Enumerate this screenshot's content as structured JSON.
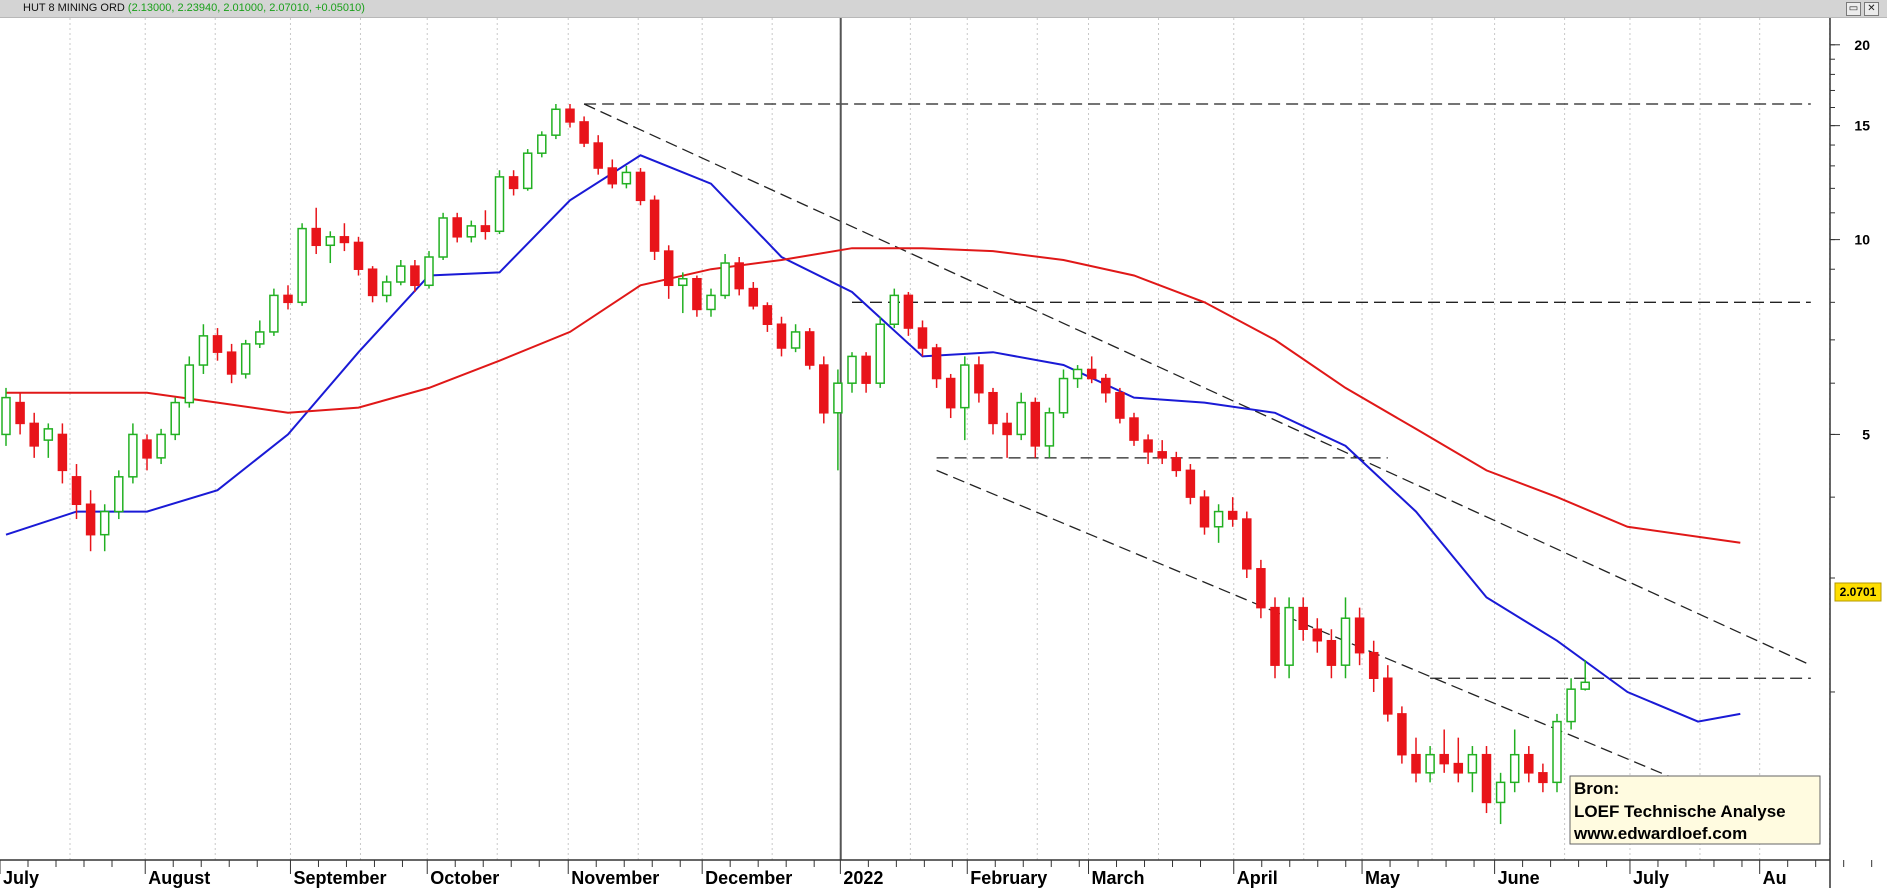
{
  "window": {
    "title": "HUT 8 MINING ORD",
    "ohlc_text": "(2.13000, 2.23940, 2.01000, 2.07010, +0.05010)",
    "restore_icon": "restore-icon",
    "close_icon": "close-icon",
    "restore_glyph": "▭",
    "close_glyph": "✕"
  },
  "colors": {
    "up": "#22b022",
    "down": "#e8141a",
    "ma_short": "#1a1ad6",
    "ma_long": "#e01818",
    "grid": "#c8c8c8",
    "last_price_bg": "#ffde00"
  },
  "chart_data": {
    "type": "candlestick",
    "title": "HUT 8 MINING ORD",
    "y_scale": "log",
    "ylim": [
      1.1,
      22
    ],
    "yticks": [
      20,
      15,
      10,
      5
    ],
    "x_labels": [
      "July",
      "August",
      "September",
      "October",
      "November",
      "December",
      "2022",
      "February",
      "March",
      "April",
      "May",
      "June",
      "July",
      "Au"
    ],
    "grid": true,
    "last_price": "2.0701",
    "last_value": 2.0701,
    "moving_averages": [
      {
        "color": "#1a1ad6",
        "points": [
          [
            0,
            3.5
          ],
          [
            5,
            3.8
          ],
          [
            10,
            3.8
          ],
          [
            15,
            4.1
          ],
          [
            20,
            5.0
          ],
          [
            25,
            6.7
          ],
          [
            30,
            8.8
          ],
          [
            35,
            8.9
          ],
          [
            40,
            11.5
          ],
          [
            45,
            13.5
          ],
          [
            50,
            12.2
          ],
          [
            55,
            9.4
          ],
          [
            60,
            8.3
          ],
          [
            65,
            6.6
          ],
          [
            70,
            6.7
          ],
          [
            75,
            6.4
          ],
          [
            80,
            5.7
          ],
          [
            85,
            5.6
          ],
          [
            90,
            5.4
          ],
          [
            95,
            4.8
          ],
          [
            100,
            3.8
          ],
          [
            105,
            2.8
          ],
          [
            110,
            2.4
          ],
          [
            115,
            2.0
          ],
          [
            120,
            1.8
          ],
          [
            123,
            1.85
          ]
        ]
      },
      {
        "color": "#e01818",
        "points": [
          [
            0,
            5.8
          ],
          [
            10,
            5.8
          ],
          [
            15,
            5.6
          ],
          [
            20,
            5.4
          ],
          [
            25,
            5.5
          ],
          [
            30,
            5.9
          ],
          [
            35,
            6.5
          ],
          [
            40,
            7.2
          ],
          [
            45,
            8.5
          ],
          [
            50,
            9.0
          ],
          [
            55,
            9.3
          ],
          [
            60,
            9.7
          ],
          [
            65,
            9.7
          ],
          [
            70,
            9.6
          ],
          [
            75,
            9.3
          ],
          [
            80,
            8.8
          ],
          [
            85,
            8.0
          ],
          [
            90,
            7.0
          ],
          [
            95,
            5.9
          ],
          [
            100,
            5.1
          ],
          [
            105,
            4.4
          ],
          [
            110,
            4.0
          ],
          [
            115,
            3.6
          ],
          [
            123,
            3.4
          ]
        ]
      }
    ],
    "trendlines": [
      {
        "from": [
          41,
          16.2
        ],
        "to": [
          128,
          16.2
        ]
      },
      {
        "from": [
          41,
          16.2
        ],
        "to": [
          128,
          2.2
        ]
      },
      {
        "from": [
          60,
          8.0
        ],
        "to": [
          128,
          8.0
        ]
      },
      {
        "from": [
          66,
          4.4
        ],
        "to": [
          128,
          1.2
        ]
      },
      {
        "from": [
          66,
          4.6
        ],
        "to": [
          98,
          4.6
        ]
      },
      {
        "from": [
          101,
          2.1
        ],
        "to": [
          128,
          2.1
        ]
      }
    ],
    "cursor_x": 59.2,
    "candles": [
      [
        5.0,
        5.9,
        4.8,
        5.7
      ],
      [
        5.6,
        5.8,
        5.0,
        5.2
      ],
      [
        5.2,
        5.4,
        4.6,
        4.8
      ],
      [
        4.9,
        5.2,
        4.6,
        5.1
      ],
      [
        5.0,
        5.2,
        4.2,
        4.4
      ],
      [
        4.3,
        4.5,
        3.7,
        3.9
      ],
      [
        3.9,
        4.1,
        3.3,
        3.5
      ],
      [
        3.5,
        3.9,
        3.3,
        3.8
      ],
      [
        3.8,
        4.4,
        3.7,
        4.3
      ],
      [
        4.3,
        5.2,
        4.2,
        5.0
      ],
      [
        4.9,
        5.0,
        4.4,
        4.6
      ],
      [
        4.6,
        5.1,
        4.5,
        5.0
      ],
      [
        5.0,
        5.7,
        4.9,
        5.6
      ],
      [
        5.6,
        6.6,
        5.5,
        6.4
      ],
      [
        6.4,
        7.4,
        6.2,
        7.1
      ],
      [
        7.1,
        7.3,
        6.5,
        6.7
      ],
      [
        6.7,
        6.9,
        6.0,
        6.2
      ],
      [
        6.2,
        7.0,
        6.1,
        6.9
      ],
      [
        6.9,
        7.5,
        6.8,
        7.2
      ],
      [
        7.2,
        8.4,
        7.1,
        8.2
      ],
      [
        8.2,
        8.5,
        7.8,
        8.0
      ],
      [
        8.0,
        10.6,
        7.9,
        10.4
      ],
      [
        10.4,
        11.2,
        9.5,
        9.8
      ],
      [
        9.8,
        10.3,
        9.2,
        10.1
      ],
      [
        10.1,
        10.6,
        9.6,
        9.9
      ],
      [
        9.9,
        10.1,
        8.8,
        9.0
      ],
      [
        9.0,
        9.1,
        8.0,
        8.2
      ],
      [
        8.2,
        8.8,
        8.0,
        8.6
      ],
      [
        8.6,
        9.3,
        8.5,
        9.1
      ],
      [
        9.1,
        9.3,
        8.3,
        8.5
      ],
      [
        8.5,
        9.6,
        8.4,
        9.4
      ],
      [
        9.4,
        11.0,
        9.3,
        10.8
      ],
      [
        10.8,
        11.0,
        9.9,
        10.1
      ],
      [
        10.1,
        10.7,
        9.9,
        10.5
      ],
      [
        10.5,
        11.1,
        10.0,
        10.3
      ],
      [
        10.3,
        12.8,
        10.2,
        12.5
      ],
      [
        12.5,
        12.8,
        11.7,
        12.0
      ],
      [
        12.0,
        13.8,
        11.9,
        13.6
      ],
      [
        13.6,
        14.7,
        13.4,
        14.5
      ],
      [
        14.5,
        16.2,
        14.3,
        15.9
      ],
      [
        15.9,
        16.2,
        14.9,
        15.2
      ],
      [
        15.2,
        15.5,
        13.9,
        14.1
      ],
      [
        14.1,
        14.5,
        12.6,
        12.9
      ],
      [
        12.9,
        13.3,
        12.0,
        12.2
      ],
      [
        12.2,
        13.0,
        12.0,
        12.7
      ],
      [
        12.7,
        12.9,
        11.3,
        11.5
      ],
      [
        11.5,
        11.7,
        9.3,
        9.6
      ],
      [
        9.6,
        9.8,
        8.1,
        8.5
      ],
      [
        8.5,
        8.9,
        7.7,
        8.7
      ],
      [
        8.7,
        8.8,
        7.6,
        7.8
      ],
      [
        7.8,
        8.4,
        7.6,
        8.2
      ],
      [
        8.2,
        9.5,
        8.1,
        9.2
      ],
      [
        9.2,
        9.4,
        8.2,
        8.4
      ],
      [
        8.4,
        8.6,
        7.8,
        7.9
      ],
      [
        7.9,
        8.0,
        7.2,
        7.4
      ],
      [
        7.4,
        7.6,
        6.6,
        6.8
      ],
      [
        6.8,
        7.4,
        6.7,
        7.2
      ],
      [
        7.2,
        7.3,
        6.3,
        6.4
      ],
      [
        6.4,
        6.6,
        5.2,
        5.4
      ],
      [
        5.4,
        6.3,
        4.4,
        6.0
      ],
      [
        6.0,
        6.7,
        5.8,
        6.6
      ],
      [
        6.6,
        6.7,
        5.8,
        6.0
      ],
      [
        6.0,
        7.6,
        5.9,
        7.4
      ],
      [
        7.4,
        8.4,
        7.3,
        8.2
      ],
      [
        8.2,
        8.3,
        7.1,
        7.3
      ],
      [
        7.3,
        7.5,
        6.6,
        6.8
      ],
      [
        6.8,
        6.9,
        5.9,
        6.1
      ],
      [
        6.1,
        6.2,
        5.3,
        5.5
      ],
      [
        5.5,
        6.6,
        4.9,
        6.4
      ],
      [
        6.4,
        6.6,
        5.6,
        5.8
      ],
      [
        5.8,
        5.9,
        5.0,
        5.2
      ],
      [
        5.2,
        5.4,
        4.6,
        5.0
      ],
      [
        5.0,
        5.8,
        4.9,
        5.6
      ],
      [
        5.6,
        5.7,
        4.6,
        4.8
      ],
      [
        4.8,
        5.5,
        4.6,
        5.4
      ],
      [
        5.4,
        6.3,
        5.3,
        6.1
      ],
      [
        6.1,
        6.4,
        5.9,
        6.3
      ],
      [
        6.3,
        6.6,
        6.0,
        6.1
      ],
      [
        6.1,
        6.2,
        5.6,
        5.8
      ],
      [
        5.8,
        5.9,
        5.2,
        5.3
      ],
      [
        5.3,
        5.4,
        4.8,
        4.9
      ],
      [
        4.9,
        5.0,
        4.5,
        4.7
      ],
      [
        4.7,
        4.9,
        4.5,
        4.6
      ],
      [
        4.6,
        4.7,
        4.3,
        4.4
      ],
      [
        4.4,
        4.5,
        3.9,
        4.0
      ],
      [
        4.0,
        4.1,
        3.5,
        3.6
      ],
      [
        3.6,
        3.9,
        3.4,
        3.8
      ],
      [
        3.8,
        4.0,
        3.6,
        3.7
      ],
      [
        3.7,
        3.8,
        3.0,
        3.1
      ],
      [
        3.1,
        3.2,
        2.6,
        2.7
      ],
      [
        2.7,
        2.8,
        2.1,
        2.2
      ],
      [
        2.2,
        2.8,
        2.1,
        2.7
      ],
      [
        2.7,
        2.8,
        2.4,
        2.5
      ],
      [
        2.5,
        2.6,
        2.3,
        2.4
      ],
      [
        2.4,
        2.5,
        2.1,
        2.2
      ],
      [
        2.2,
        2.8,
        2.1,
        2.6
      ],
      [
        2.6,
        2.7,
        2.2,
        2.3
      ],
      [
        2.3,
        2.4,
        2.0,
        2.1
      ],
      [
        2.1,
        2.2,
        1.8,
        1.85
      ],
      [
        1.85,
        1.9,
        1.55,
        1.6
      ],
      [
        1.6,
        1.7,
        1.45,
        1.5
      ],
      [
        1.5,
        1.65,
        1.45,
        1.6
      ],
      [
        1.6,
        1.75,
        1.5,
        1.55
      ],
      [
        1.55,
        1.7,
        1.45,
        1.5
      ],
      [
        1.5,
        1.65,
        1.4,
        1.6
      ],
      [
        1.6,
        1.65,
        1.3,
        1.35
      ],
      [
        1.35,
        1.5,
        1.25,
        1.45
      ],
      [
        1.45,
        1.75,
        1.4,
        1.6
      ],
      [
        1.6,
        1.65,
        1.45,
        1.5
      ],
      [
        1.5,
        1.55,
        1.4,
        1.45
      ],
      [
        1.45,
        1.85,
        1.4,
        1.8
      ],
      [
        1.8,
        2.1,
        1.75,
        2.02
      ],
      [
        2.02,
        2.24,
        2.01,
        2.07
      ]
    ]
  },
  "source_box": {
    "line1": "Bron:",
    "line2": "LOEF Technische Analyse",
    "line3": "www.edwardloef.com"
  }
}
